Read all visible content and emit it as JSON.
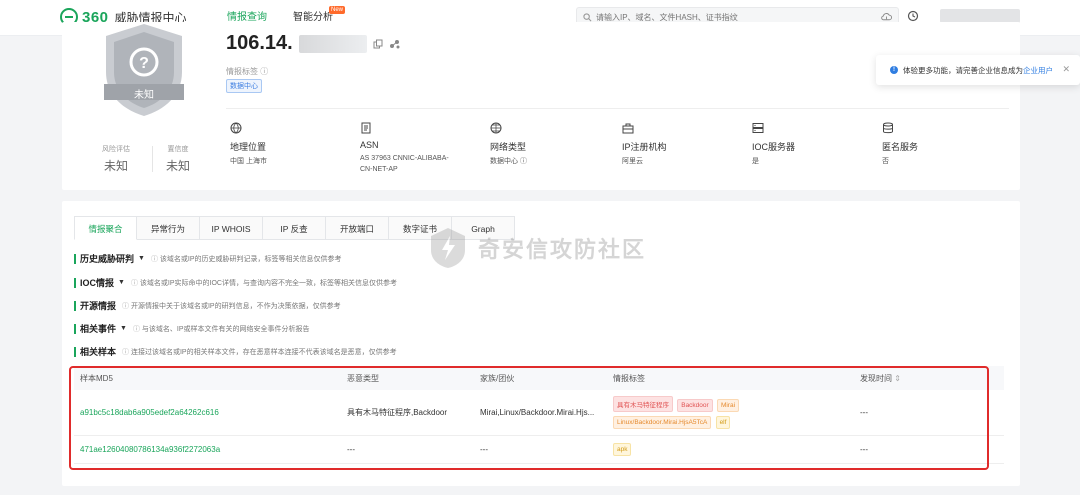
{
  "header": {
    "brand": "360",
    "app_name": "威胁情报中心",
    "nav": [
      {
        "label": "情报查询"
      },
      {
        "label": "智能分析",
        "badge": "New"
      }
    ],
    "search_placeholder": "请输入IP、域名、文件HASH、证书指纹"
  },
  "summary": {
    "ip": "106.14.",
    "shield_label": "未知",
    "risk": [
      {
        "key": "风险评估",
        "value": "未知"
      },
      {
        "key": "置信度",
        "value": "未知"
      }
    ],
    "tags_label": "情报标签",
    "tags": [
      "数据中心"
    ],
    "attributes": [
      {
        "icon": "globe-icon",
        "name": "地理位置",
        "value": "中国 上海市"
      },
      {
        "icon": "document-icon",
        "name": "ASN",
        "value": "AS 37963 CNNIC-ALIBABA-CN-NET-AP"
      },
      {
        "icon": "network-icon",
        "name": "网络类型",
        "value": "数据中心"
      },
      {
        "icon": "briefcase-icon",
        "name": "IP注册机构",
        "value": "阿里云"
      },
      {
        "icon": "server-icon",
        "name": "IOC服务器",
        "value": "是"
      },
      {
        "icon": "database-icon",
        "name": "匿名服务",
        "value": "否"
      }
    ]
  },
  "notice": {
    "text": "体验更多功能，请完善企业信息成为",
    "link": "企业用户"
  },
  "tabs": [
    "情报聚合",
    "异常行为",
    "IP WHOIS",
    "IP 反查",
    "开放端口",
    "数字证书",
    "Graph"
  ],
  "sections": [
    {
      "title": "历史威胁研判",
      "tip": "该域名或IP的历史威胁研判记录，标签等相关信息仅供参考",
      "dropdown": true
    },
    {
      "title": "IOC情报",
      "tip": "该域名或IP实际命中的IOC详情，与查询内容不完全一致，标签等相关信息仅供参考",
      "dropdown": true
    },
    {
      "title": "开源情报",
      "tip": "开源情报中关于该域名或IP的研判信息，不作为决策依据，仅供参考",
      "dropdown": false
    },
    {
      "title": "相关事件",
      "tip": "与该域名、IP或样本文件有关的网络安全事件分析报告",
      "dropdown": true
    },
    {
      "title": "相关样本",
      "tip": "连接过该域名或IP的相关样本文件，存在恶意样本连接不代表该域名是恶意，仅供参考",
      "dropdown": false
    }
  ],
  "table": {
    "columns": [
      "样本MD5",
      "恶意类型",
      "家族/团伙",
      "情报标签",
      "发现时间"
    ],
    "rows": [
      {
        "md5": "a91bc5c18dab6a905edef2a64262c616",
        "type": "具有木马特征程序,Backdoor",
        "family": "Mirai,Linux/Backdoor.Mirai.Hjs...",
        "tags": [
          {
            "text": "具有木马特征程序",
            "color": "red"
          },
          {
            "text": "Backdoor",
            "color": "red"
          },
          {
            "text": "Mirai",
            "color": "orange"
          },
          {
            "text": "Linux/Backdoor.Mirai.HjsA5TcA",
            "color": "orange"
          },
          {
            "text": "elf",
            "color": "yellow"
          }
        ],
        "time": "---"
      },
      {
        "md5": "471ae12604080786134a936f2272063a",
        "type": "---",
        "family": "---",
        "tags": [
          {
            "text": "apk",
            "color": "yellow"
          }
        ],
        "time": "---"
      }
    ]
  },
  "watermark": "奇安信攻防社区",
  "colors": {
    "accent": "#1aa55b",
    "highlight_box": "#e02b2b",
    "link": "#2f7de1"
  }
}
